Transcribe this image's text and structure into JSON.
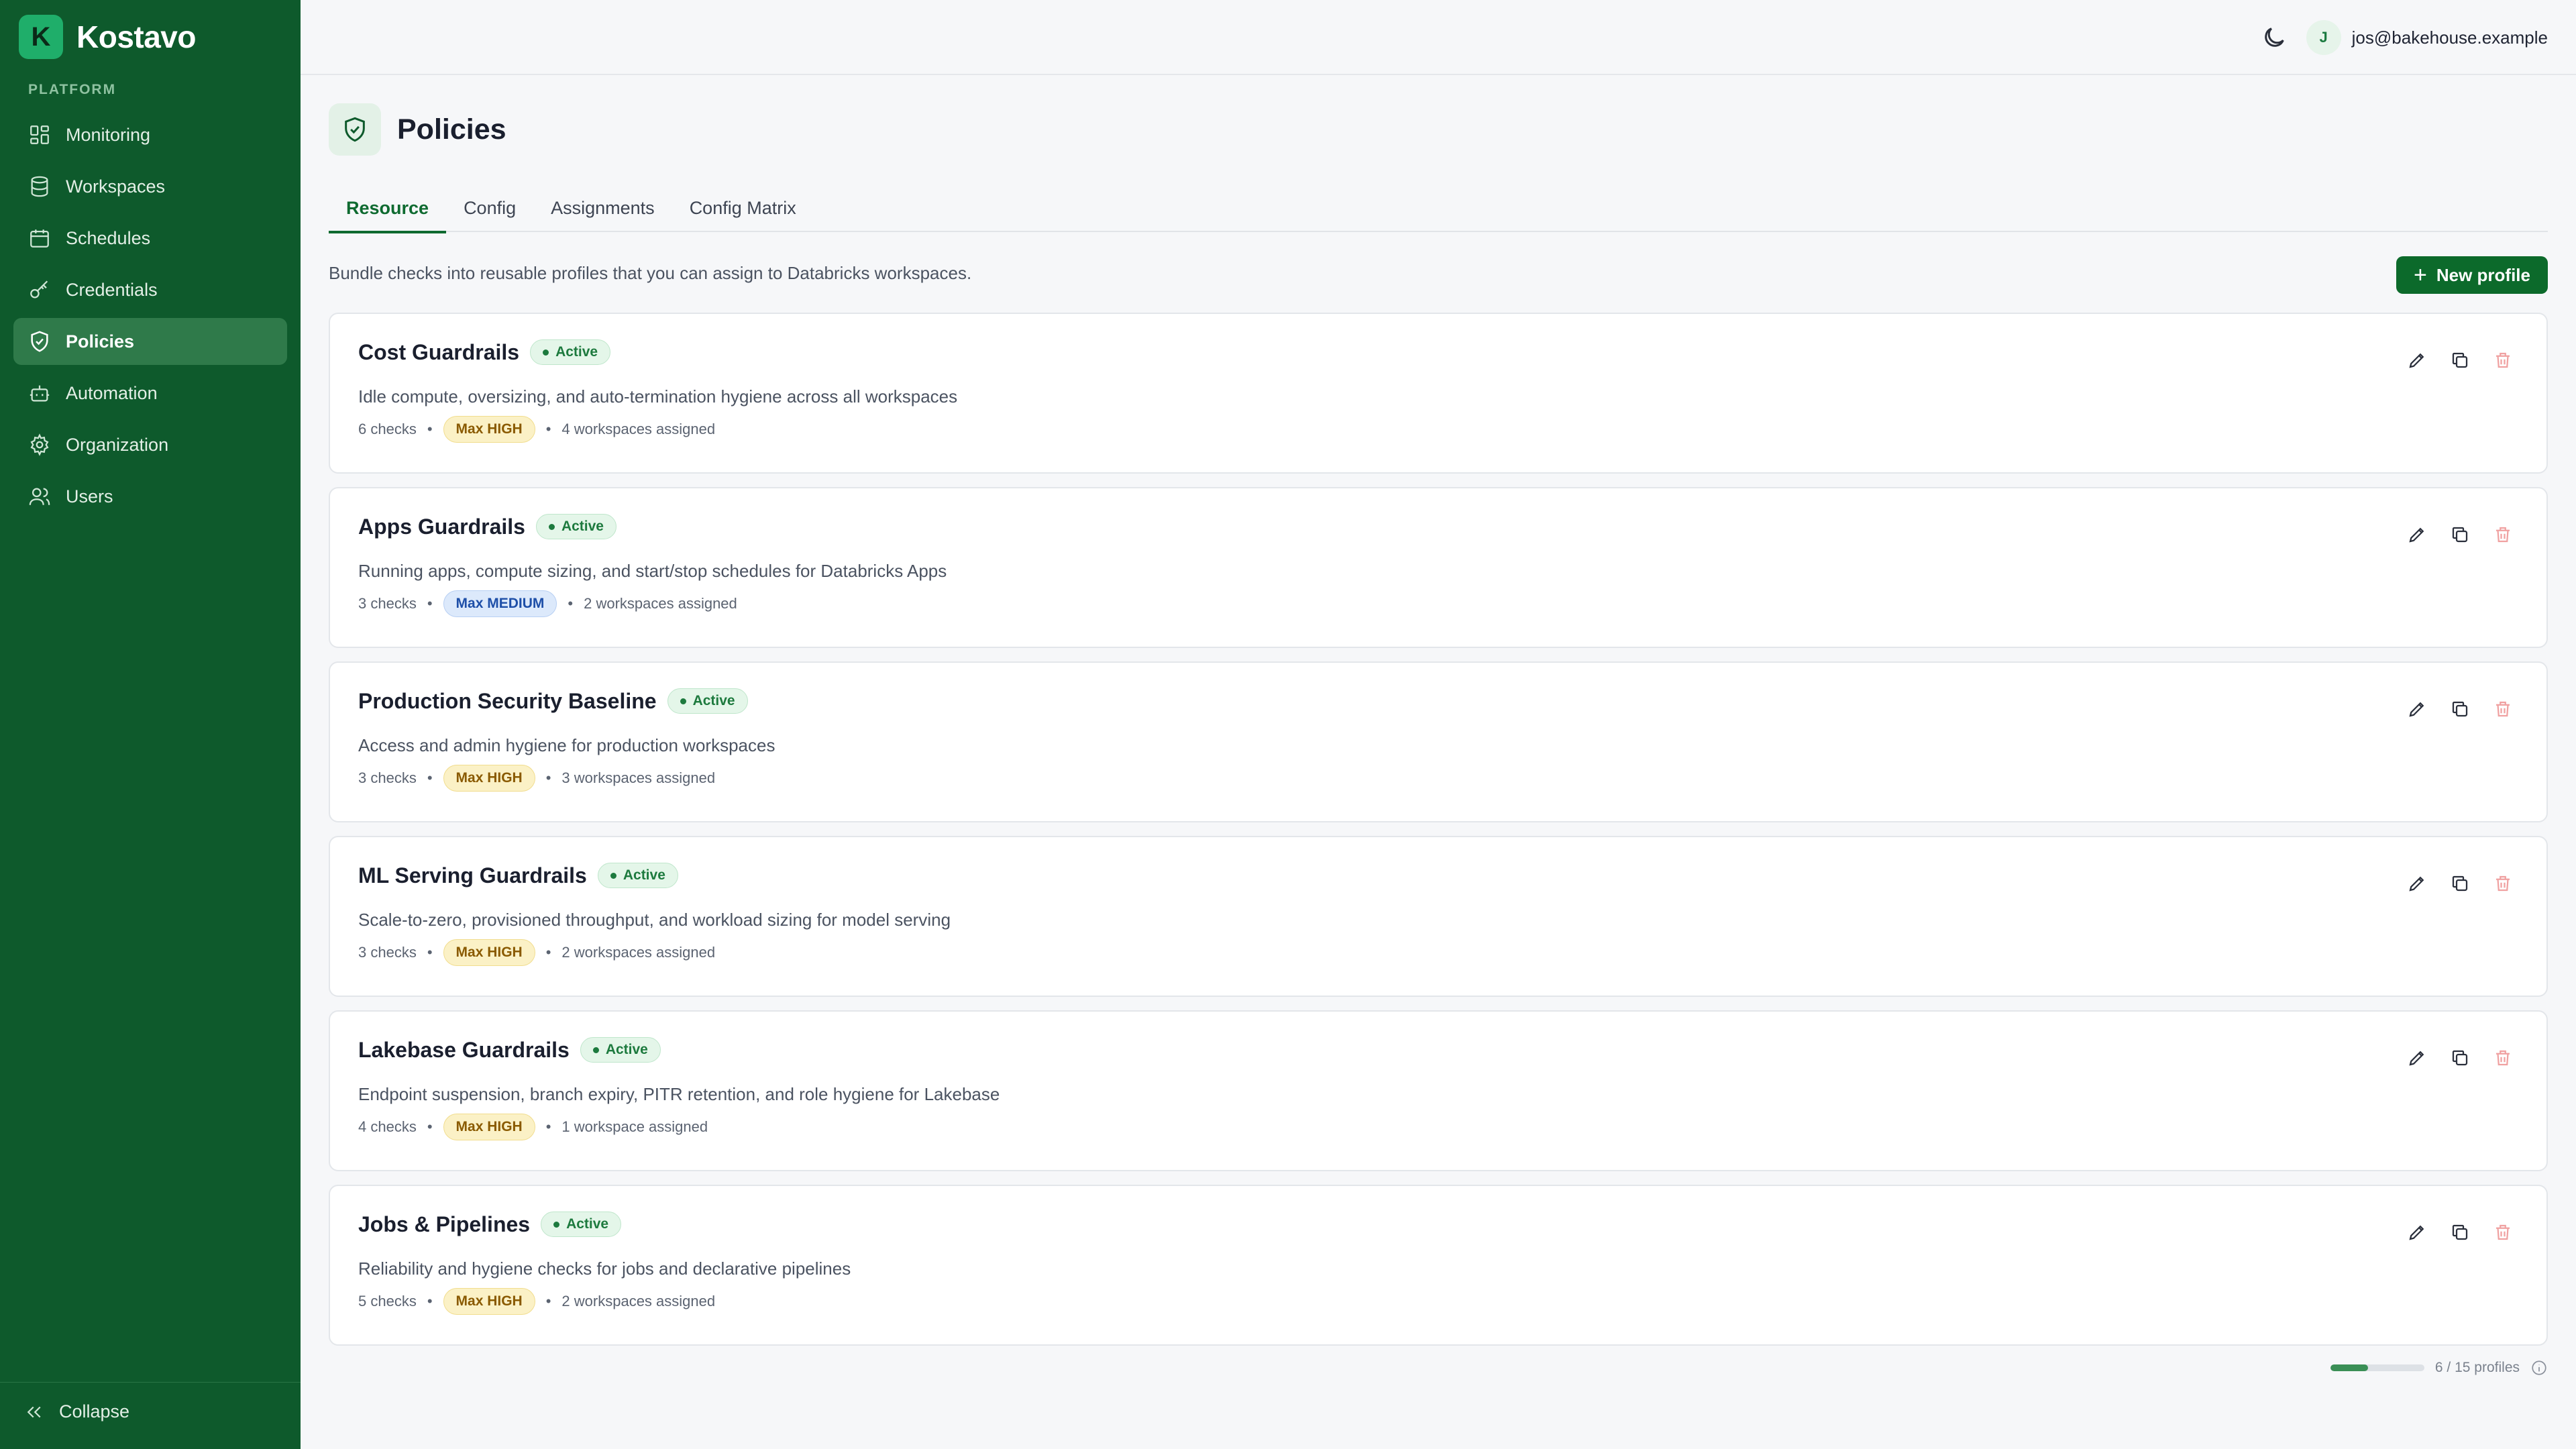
{
  "brand": {
    "logo_letter": "K",
    "name": "Kostavo",
    "accent": "#1fae6a"
  },
  "sidebar": {
    "section_label": "PLATFORM",
    "items": [
      {
        "label": "Monitoring",
        "icon": "dashboard-icon"
      },
      {
        "label": "Workspaces",
        "icon": "database-icon"
      },
      {
        "label": "Schedules",
        "icon": "calendar-icon"
      },
      {
        "label": "Credentials",
        "icon": "key-icon"
      },
      {
        "label": "Policies",
        "icon": "shield-icon",
        "active": true
      },
      {
        "label": "Automation",
        "icon": "bot-icon"
      },
      {
        "label": "Organization",
        "icon": "gear-icon"
      },
      {
        "label": "Users",
        "icon": "users-icon"
      }
    ],
    "collapse_label": "Collapse"
  },
  "topbar": {
    "user_initial": "J",
    "user_email": "jos@bakehouse.example"
  },
  "page": {
    "title": "Policies",
    "tabs": [
      {
        "label": "Resource",
        "active": true
      },
      {
        "label": "Config"
      },
      {
        "label": "Assignments"
      },
      {
        "label": "Config Matrix"
      }
    ],
    "intro": "Bundle checks into reusable profiles that you can assign to Databricks workspaces.",
    "new_button_label": "New profile"
  },
  "profiles": [
    {
      "name": "Cost Guardrails",
      "status": "Active",
      "description": "Idle compute, oversizing, and auto-termination hygiene across all workspaces",
      "checks": "6 checks",
      "severity": "Max HIGH",
      "severity_level": "high",
      "assigned": "4 workspaces assigned"
    },
    {
      "name": "Apps Guardrails",
      "status": "Active",
      "description": "Running apps, compute sizing, and start/stop schedules for Databricks Apps",
      "checks": "3 checks",
      "severity": "Max MEDIUM",
      "severity_level": "medium",
      "assigned": "2 workspaces assigned"
    },
    {
      "name": "Production Security Baseline",
      "status": "Active",
      "description": "Access and admin hygiene for production workspaces",
      "checks": "3 checks",
      "severity": "Max HIGH",
      "severity_level": "high",
      "assigned": "3 workspaces assigned"
    },
    {
      "name": "ML Serving Guardrails",
      "status": "Active",
      "description": "Scale-to-zero, provisioned throughput, and workload sizing for model serving",
      "checks": "3 checks",
      "severity": "Max HIGH",
      "severity_level": "high",
      "assigned": "2 workspaces assigned"
    },
    {
      "name": "Lakebase Guardrails",
      "status": "Active",
      "description": "Endpoint suspension, branch expiry, PITR retention, and role hygiene for Lakebase",
      "checks": "4 checks",
      "severity": "Max HIGH",
      "severity_level": "high",
      "assigned": "1 workspace assigned"
    },
    {
      "name": "Jobs & Pipelines",
      "status": "Active",
      "description": "Reliability and hygiene checks for jobs and declarative pipelines",
      "checks": "5 checks",
      "severity": "Max HIGH",
      "severity_level": "high",
      "assigned": "2 workspaces assigned"
    }
  ],
  "quota": {
    "label": "6 / 15 profiles",
    "used": 6,
    "total": 15
  }
}
